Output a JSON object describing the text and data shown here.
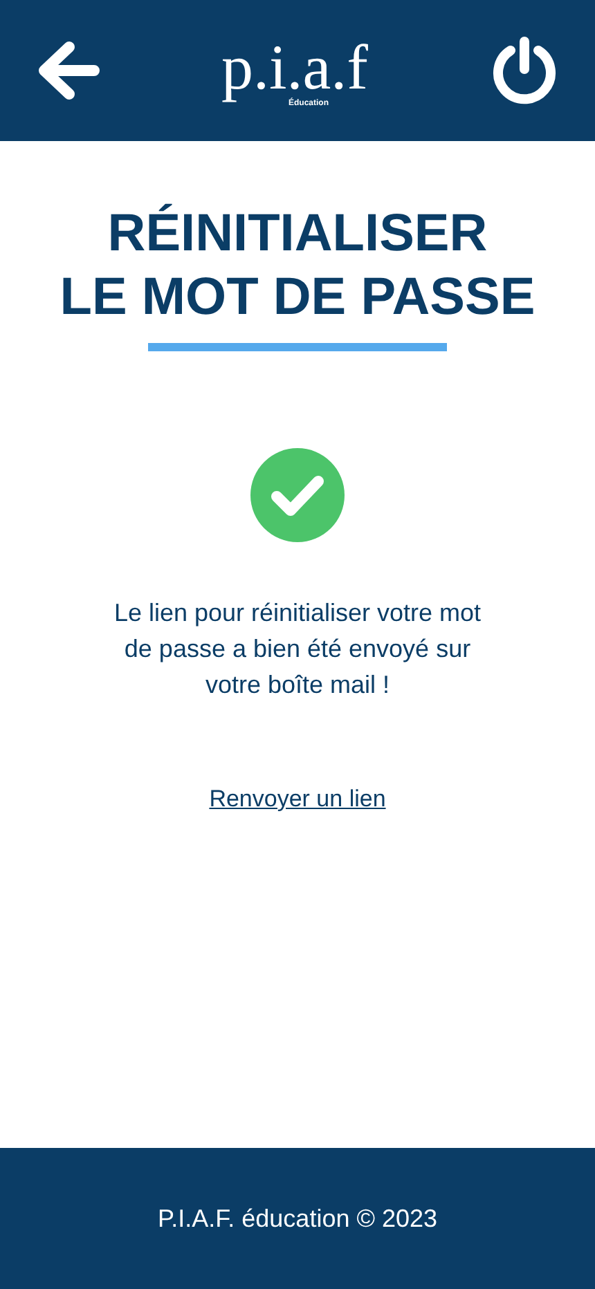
{
  "header": {
    "logo": "p.i.a.f",
    "logo_subtitle": "Éducation"
  },
  "title": [
    "RÉINITIALISER",
    "LE MOT DE PASSE"
  ],
  "message": "Le lien pour réinitialiser votre mot de passe a bien été envoyé sur votre boîte mail !",
  "link": "Renvoyer un lien",
  "footer": "P.I.A.F. éducation © 2023"
}
